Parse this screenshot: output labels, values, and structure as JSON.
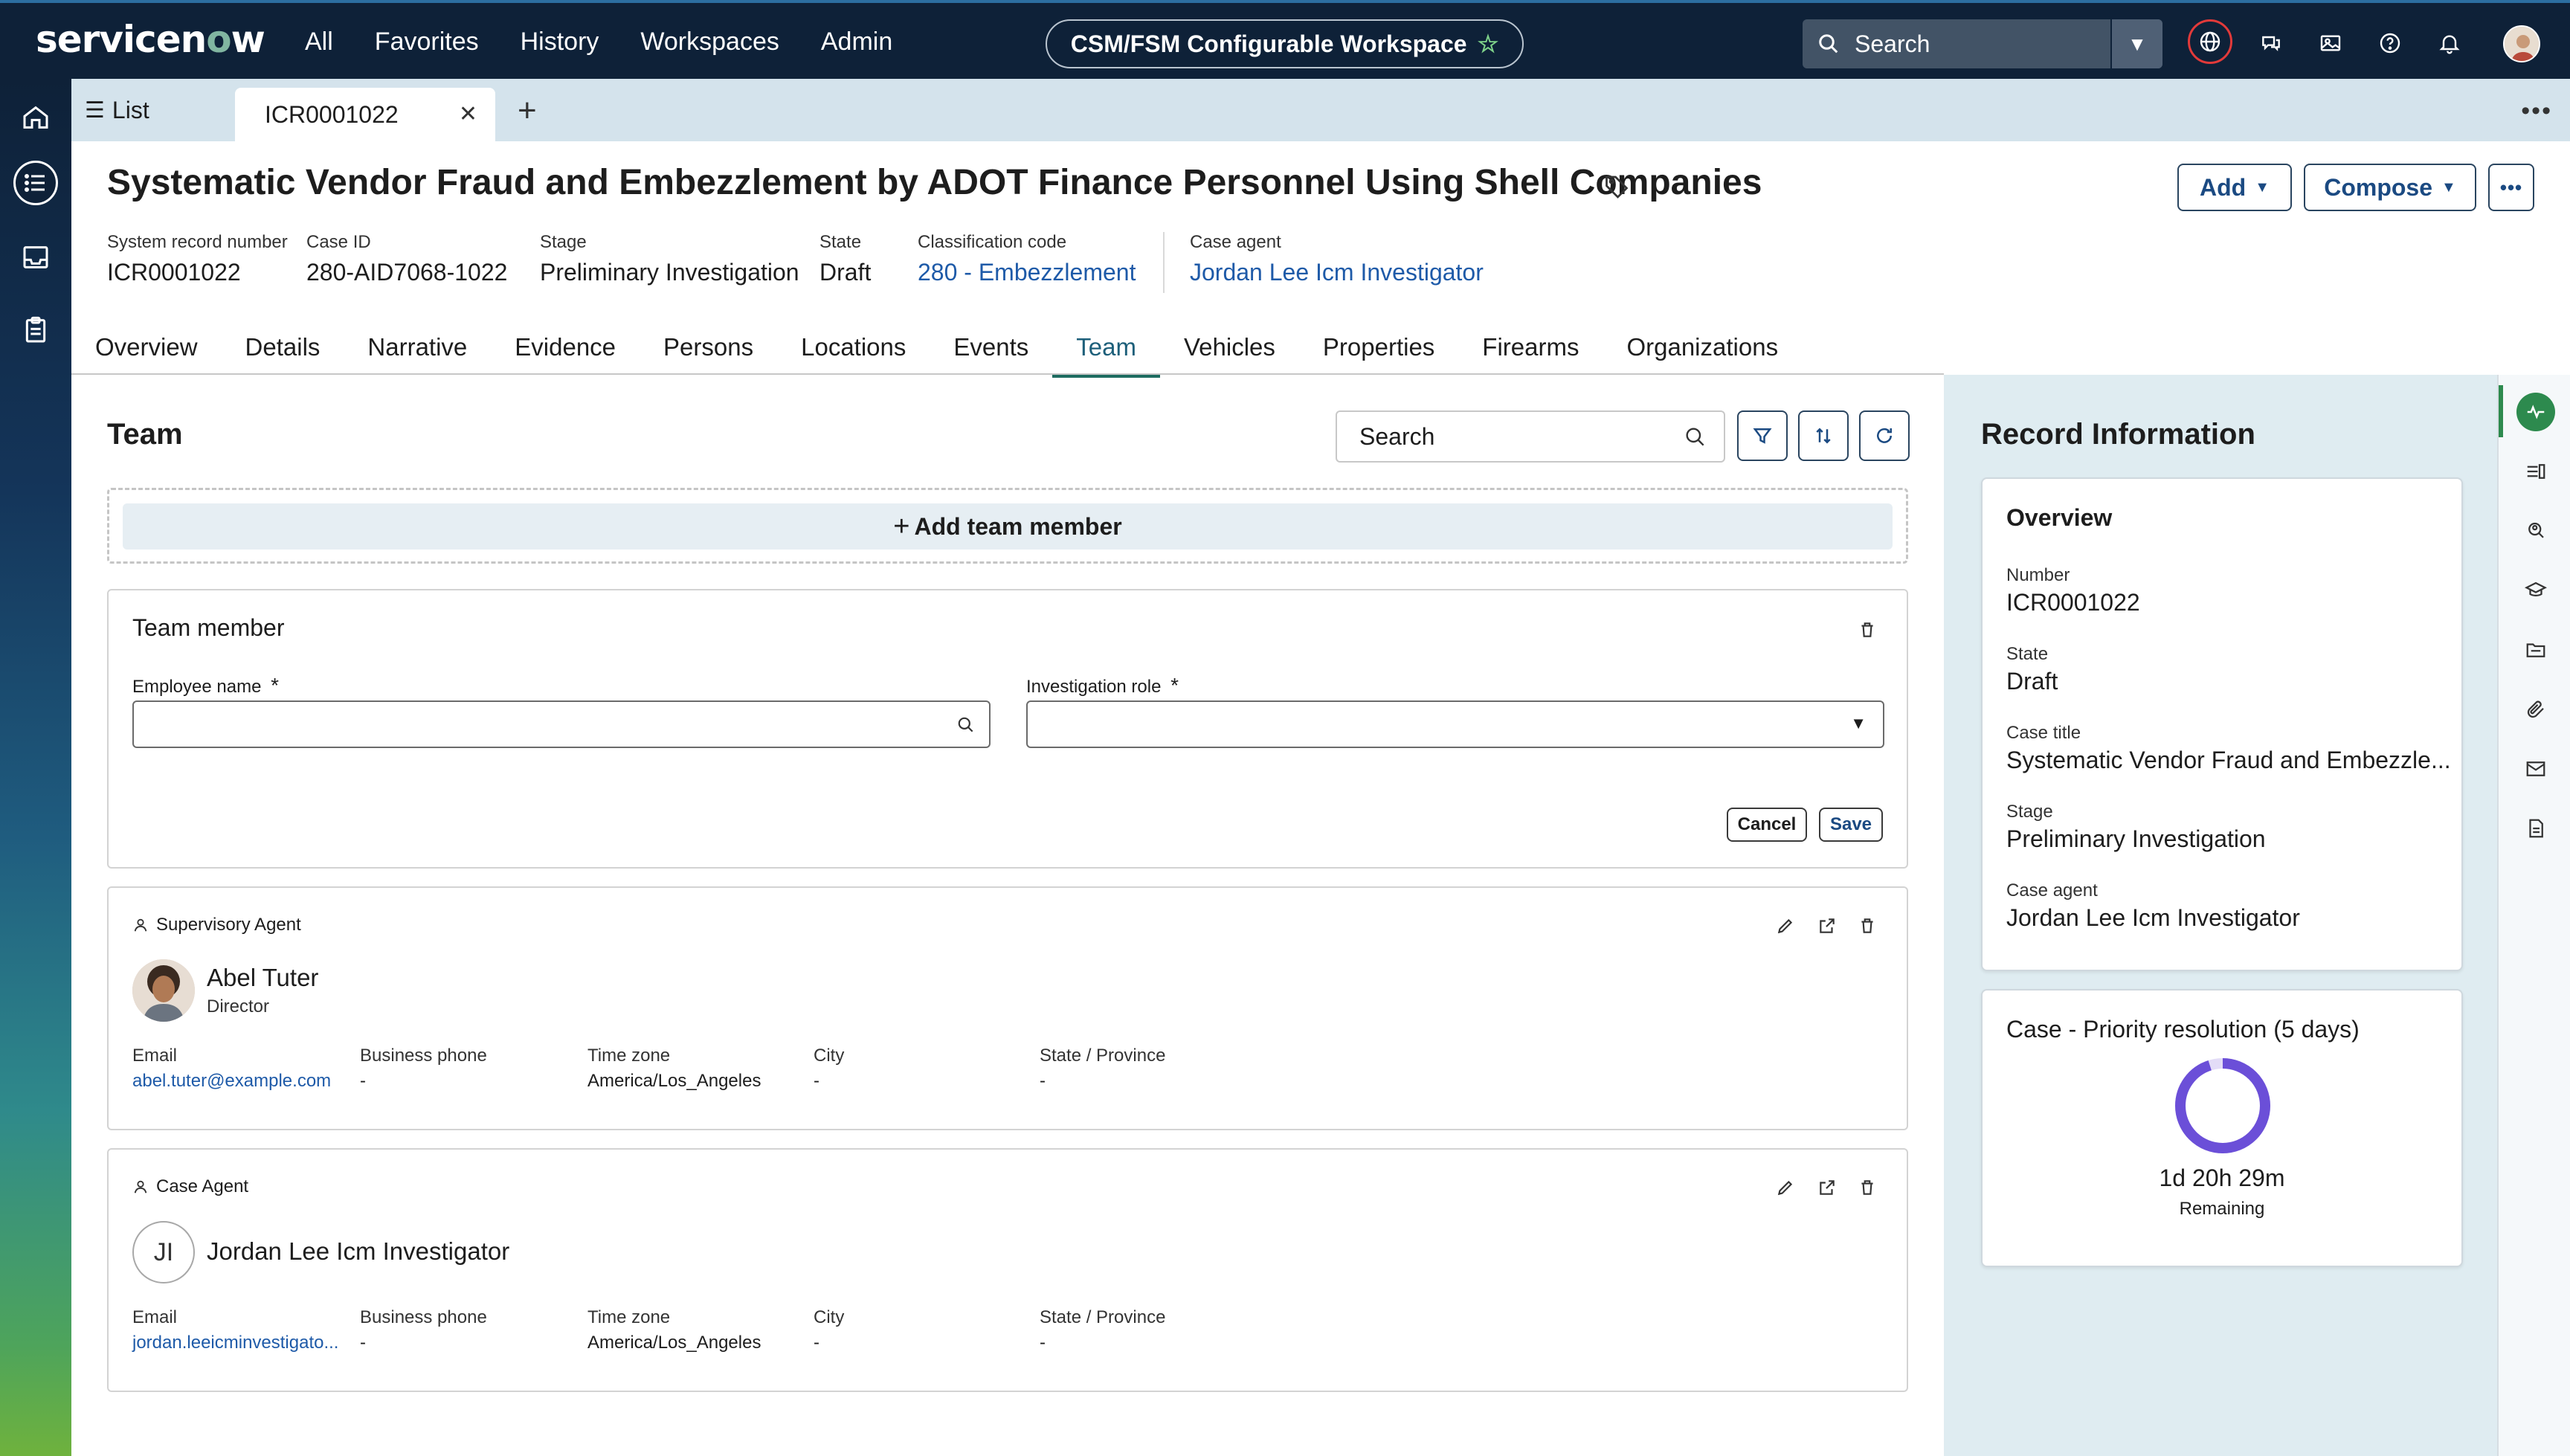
{
  "header": {
    "logo": "servicenow",
    "nav": [
      "All",
      "Favorites",
      "History",
      "Workspaces",
      "Admin"
    ],
    "workspace": "CSM/FSM Configurable Workspace",
    "search_placeholder": "Search"
  },
  "tabs": {
    "list_label": "List",
    "record_tab": "ICR0001022"
  },
  "record": {
    "title": "Systematic Vendor Fraud and Embezzlement by ADOT Finance Personnel Using Shell Companies",
    "fields": [
      {
        "label": "System record number",
        "value": "ICR0001022"
      },
      {
        "label": "Case ID",
        "value": "280-AID7068-1022"
      },
      {
        "label": "Stage",
        "value": "Preliminary Investigation"
      },
      {
        "label": "State",
        "value": "Draft"
      },
      {
        "label": "Classification code",
        "value": "280 - Embezzlement"
      },
      {
        "label": "Case agent",
        "value": "Jordan Lee Icm Investigator"
      }
    ],
    "buttons": {
      "add": "Add",
      "compose": "Compose"
    }
  },
  "subtabs": [
    "Overview",
    "Details",
    "Narrative",
    "Evidence",
    "Persons",
    "Locations",
    "Events",
    "Team",
    "Vehicles",
    "Properties",
    "Firearms",
    "Organizations"
  ],
  "team": {
    "heading": "Team",
    "search_placeholder": "Search",
    "add_member": "Add team member",
    "form": {
      "heading": "Team member",
      "employee_label": "Employee name",
      "role_label": "Investigation role",
      "required_mark": "*",
      "cancel": "Cancel",
      "save": "Save"
    },
    "contact_labels": {
      "email": "Email",
      "phone": "Business phone",
      "tz": "Time zone",
      "city": "City",
      "state": "State / Province"
    },
    "members": [
      {
        "role": "Supervisory Agent",
        "name": "Abel Tuter",
        "title": "Director",
        "initials": "",
        "email": "abel.tuter@example.com",
        "phone": "-",
        "tz": "America/Los_Angeles",
        "city": "-",
        "state": "-"
      },
      {
        "role": "Case Agent",
        "name": "Jordan Lee Icm Investigator",
        "title": "",
        "initials": "JI",
        "email": "jordan.leeicminvestigato...",
        "phone": "-",
        "tz": "America/Los_Angeles",
        "city": "-",
        "state": "-"
      }
    ]
  },
  "record_info": {
    "heading": "Record Information",
    "overview": {
      "heading": "Overview",
      "items": [
        {
          "label": "Number",
          "value": "ICR0001022"
        },
        {
          "label": "State",
          "value": "Draft"
        },
        {
          "label": "Case title",
          "value": "Systematic Vendor Fraud and Embezzle..."
        },
        {
          "label": "Stage",
          "value": "Preliminary Investigation"
        },
        {
          "label": "Case agent",
          "value": "Jordan Lee Icm Investigator"
        }
      ]
    },
    "sla": {
      "heading": "Case - Priority resolution (5 days)",
      "time": "1d 20h 29m",
      "sub": "Remaining",
      "remaining_fraction": 0.95,
      "ring_color": "#6b4fd8"
    }
  },
  "colors": {
    "header_bg": "#0e2138",
    "link": "#1e5aa8",
    "active_tab": "#1d6b5f"
  }
}
